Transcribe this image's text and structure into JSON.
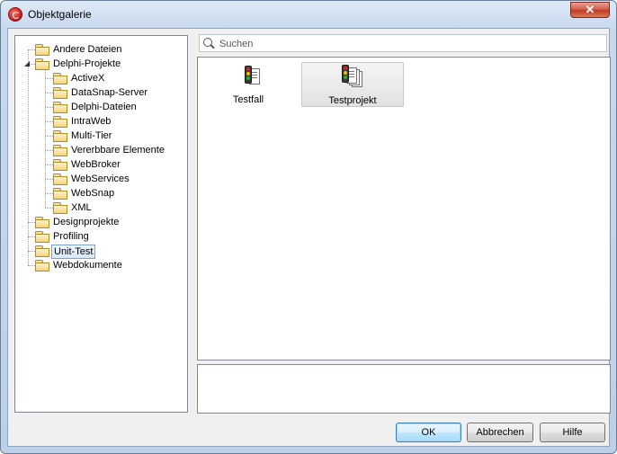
{
  "window": {
    "title": "Objektgalerie",
    "close_glyph": "✕"
  },
  "tree": {
    "items": [
      {
        "label": "Andere Dateien",
        "level": 0
      },
      {
        "label": "Delphi-Projekte",
        "level": 0,
        "expanded": true
      },
      {
        "label": "ActiveX",
        "level": 1
      },
      {
        "label": "DataSnap-Server",
        "level": 1
      },
      {
        "label": "Delphi-Dateien",
        "level": 1
      },
      {
        "label": "IntraWeb",
        "level": 1
      },
      {
        "label": "Multi-Tier",
        "level": 1
      },
      {
        "label": "Vererbbare Elemente",
        "level": 1
      },
      {
        "label": "WebBroker",
        "level": 1
      },
      {
        "label": "WebServices",
        "level": 1
      },
      {
        "label": "WebSnap",
        "level": 1
      },
      {
        "label": "XML",
        "level": 1
      },
      {
        "label": "Designprojekte",
        "level": 0
      },
      {
        "label": "Profiling",
        "level": 0
      },
      {
        "label": "Unit-Test",
        "level": 0,
        "selected": true
      },
      {
        "label": "Webdokumente",
        "level": 0
      }
    ]
  },
  "search": {
    "placeholder": "Suchen",
    "value": ""
  },
  "gallery": {
    "items": [
      {
        "label": "Testfall",
        "icon": "traffic-light-icon",
        "selected": false
      },
      {
        "label": "Testprojekt",
        "icon": "traffic-light-documents-icon",
        "selected": true
      }
    ]
  },
  "buttons": {
    "ok": "OK",
    "cancel": "Abbrechen",
    "help": "Hilfe"
  },
  "colors": {
    "selection_border": "#7da2ce",
    "default_button_border": "#3c7fb1",
    "close_button": "#c23b22"
  }
}
